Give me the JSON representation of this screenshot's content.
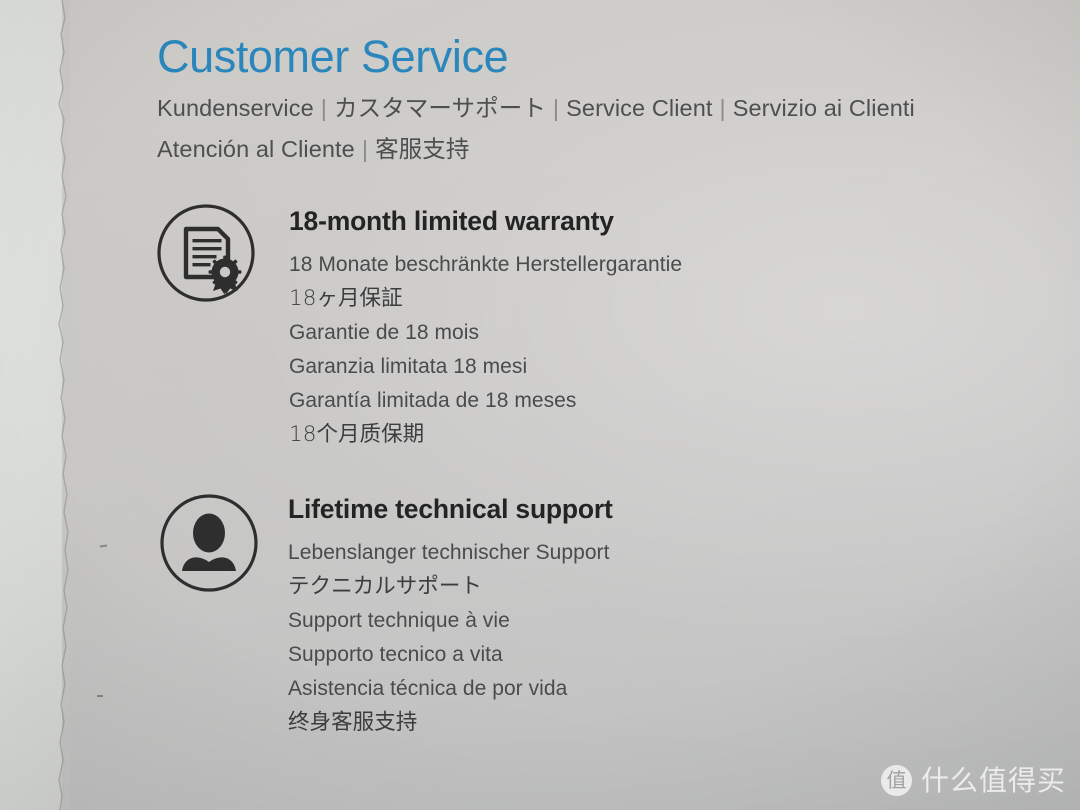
{
  "header": {
    "title": "Customer Service",
    "translations": [
      "Kundenservice",
      "カスタマーサポート",
      "Service Client",
      "Servizio ai Clienti",
      "Atención al Cliente",
      "客服支持"
    ],
    "separator": "|"
  },
  "features": [
    {
      "icon": "certificate-document-icon",
      "title": "18-month limited warranty",
      "lines": [
        "18 Monate beschränkte Herstellergarantie",
        "18ヶ月保証",
        "Garantie de 18 mois",
        "Garanzia limitata 18 mesi",
        "Garantía limitada de 18 meses",
        "18个月质保期"
      ]
    },
    {
      "icon": "person-support-icon",
      "title": "Lifetime technical support",
      "lines": [
        "Lebenslanger technischer Support",
        "テクニカルサポート",
        "Support technique à vie",
        "Supporto tecnico a vita",
        "Asistencia técnica de por vida",
        "终身客服支持"
      ]
    }
  ],
  "watermark": {
    "badge_glyph": "值",
    "text": "什么值得买"
  },
  "colors": {
    "title_blue": "#2a86bb",
    "body_gray": "#4a4b4c",
    "heading_dark": "#242424",
    "paper_main": "#c9c8c5",
    "paper_left_strip": "#dcdeda",
    "icon_stroke": "#2e2e2e"
  }
}
